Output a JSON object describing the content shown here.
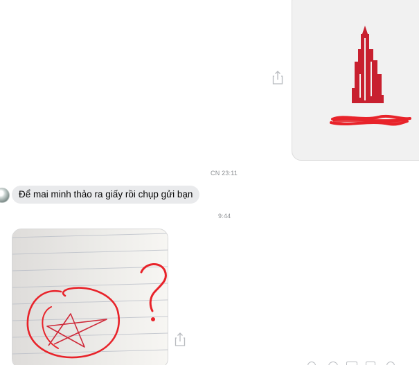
{
  "timestamps": {
    "first": "CN 23:11",
    "second": "9:44"
  },
  "messages": {
    "incoming_text": "Để mai minh thảo ra giấy rồi chụp gửi bạn"
  },
  "icons": {
    "share": "share-icon",
    "building": "building-logo",
    "star": "star-drawing",
    "question": "question-mark-drawing"
  },
  "colors": {
    "logo_red": "#c8202f",
    "ink_red": "#e8232a",
    "bubble_bg": "#e9eaec"
  }
}
